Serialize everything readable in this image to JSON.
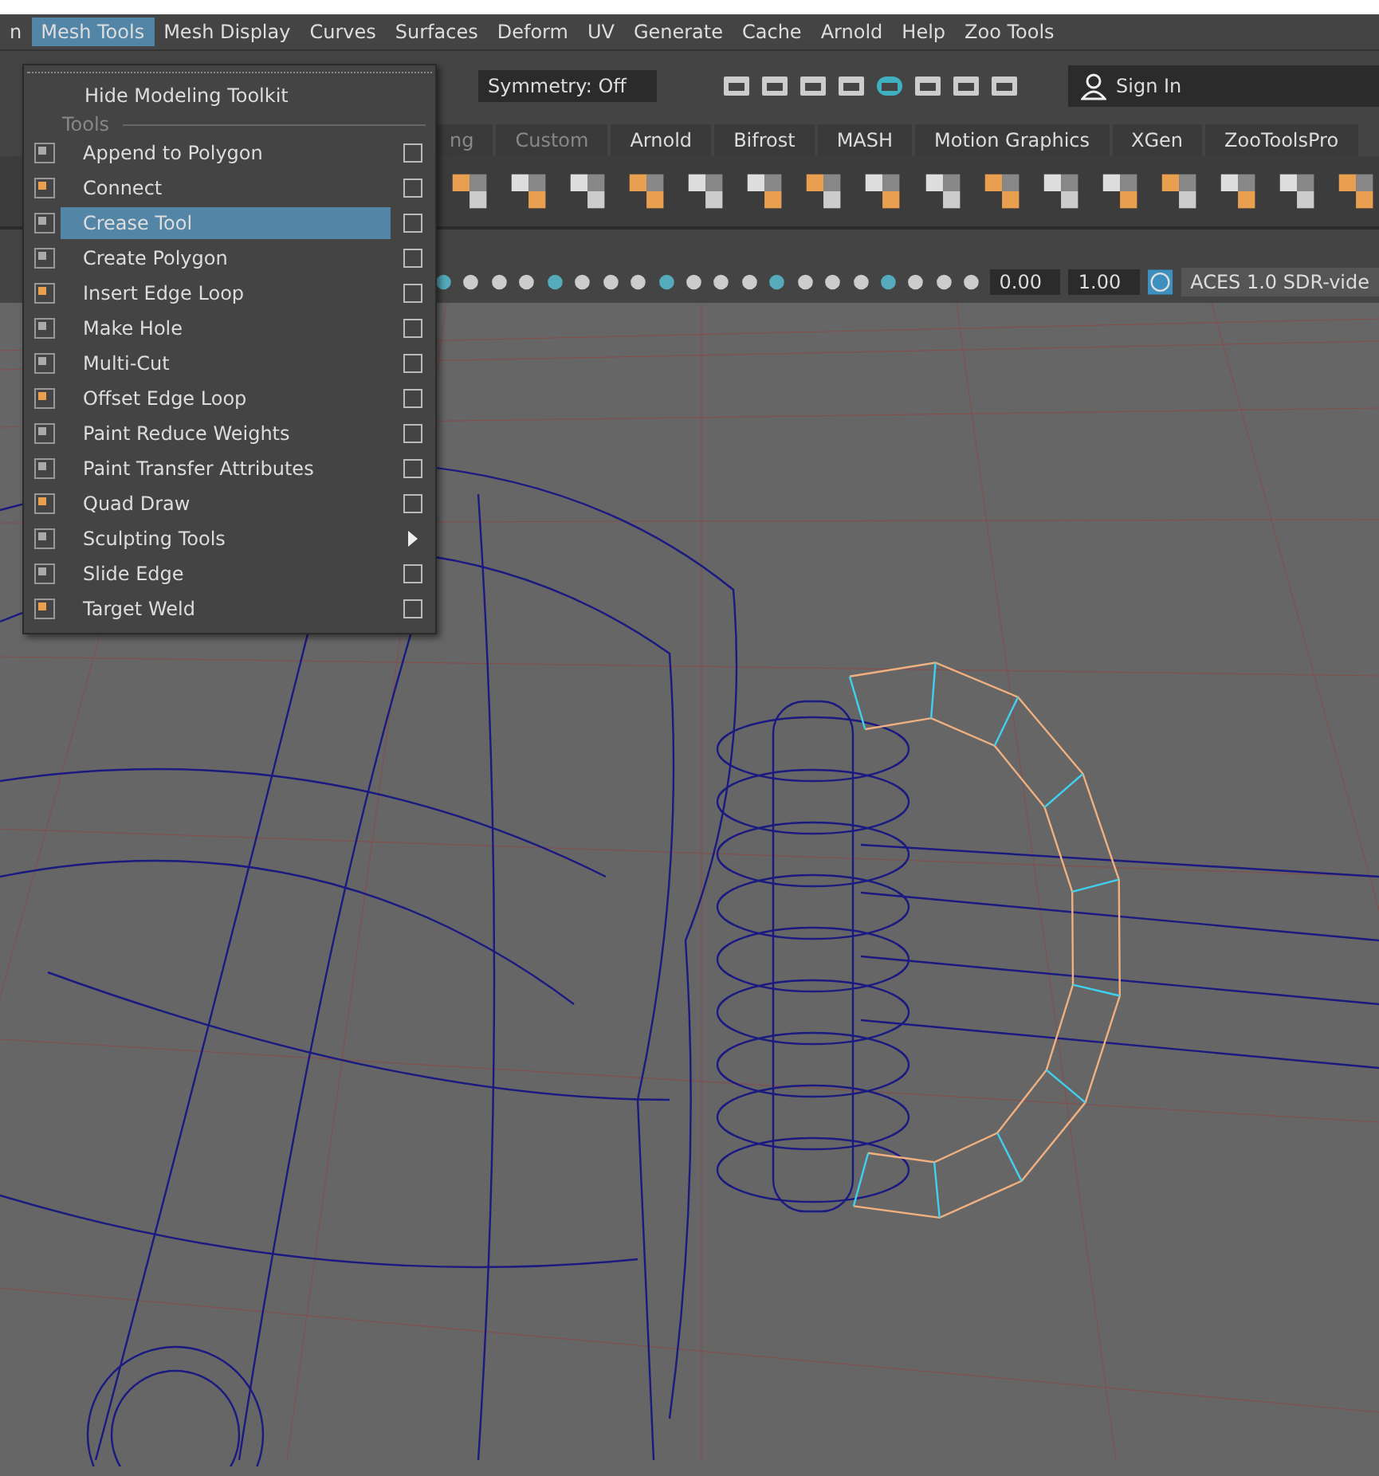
{
  "menu_bar": {
    "items": [
      {
        "label": "n",
        "selected": false
      },
      {
        "label": "Mesh Tools",
        "selected": true
      },
      {
        "label": "Mesh Display",
        "selected": false
      },
      {
        "label": "Curves",
        "selected": false
      },
      {
        "label": "Surfaces",
        "selected": false
      },
      {
        "label": "Deform",
        "selected": false
      },
      {
        "label": "UV",
        "selected": false
      },
      {
        "label": "Generate",
        "selected": false
      },
      {
        "label": "Cache",
        "selected": false
      },
      {
        "label": "Arnold",
        "selected": false
      },
      {
        "label": "Help",
        "selected": false
      },
      {
        "label": "Zoo Tools",
        "selected": false
      }
    ]
  },
  "status_line": {
    "symmetry": "Symmetry: Off",
    "sign_in": "Sign In"
  },
  "shelf_tabs": [
    {
      "label": "ng",
      "selected": false
    },
    {
      "label": "Custom",
      "selected": false
    },
    {
      "label": "Arnold",
      "selected": false
    },
    {
      "label": "Bifrost",
      "selected": false
    },
    {
      "label": "MASH",
      "selected": false
    },
    {
      "label": "Motion Graphics",
      "selected": false
    },
    {
      "label": "XGen",
      "selected": false
    },
    {
      "label": "ZooToolsPro",
      "selected": false
    }
  ],
  "viewport_toolbar": {
    "exposure": "0.00",
    "gamma": "1.00",
    "color_management": "ACES 1.0 SDR-vide",
    "color_management_on": true
  },
  "dropdown_menu": {
    "header_item": "Hide Modeling Toolkit",
    "section": "Tools",
    "items": [
      {
        "label": "Append to Polygon",
        "kind": "option",
        "selected": false
      },
      {
        "label": "Connect",
        "kind": "option",
        "selected": false
      },
      {
        "label": "Crease Tool",
        "kind": "option",
        "selected": true
      },
      {
        "label": "Create Polygon",
        "kind": "option",
        "selected": false
      },
      {
        "label": "Insert Edge Loop",
        "kind": "option",
        "selected": false
      },
      {
        "label": "Make Hole",
        "kind": "option",
        "selected": false
      },
      {
        "label": "Multi-Cut",
        "kind": "option",
        "selected": false
      },
      {
        "label": "Offset Edge Loop",
        "kind": "option",
        "selected": false
      },
      {
        "label": "Paint Reduce Weights",
        "kind": "option",
        "selected": false
      },
      {
        "label": "Paint Transfer Attributes",
        "kind": "option",
        "selected": false
      },
      {
        "label": "Quad Draw",
        "kind": "option",
        "selected": false
      },
      {
        "label": "Sculpting Tools",
        "kind": "submenu",
        "selected": false
      },
      {
        "label": "Slide Edge",
        "kind": "option",
        "selected": false
      },
      {
        "label": "Target Weld",
        "kind": "option",
        "selected": false
      }
    ]
  }
}
